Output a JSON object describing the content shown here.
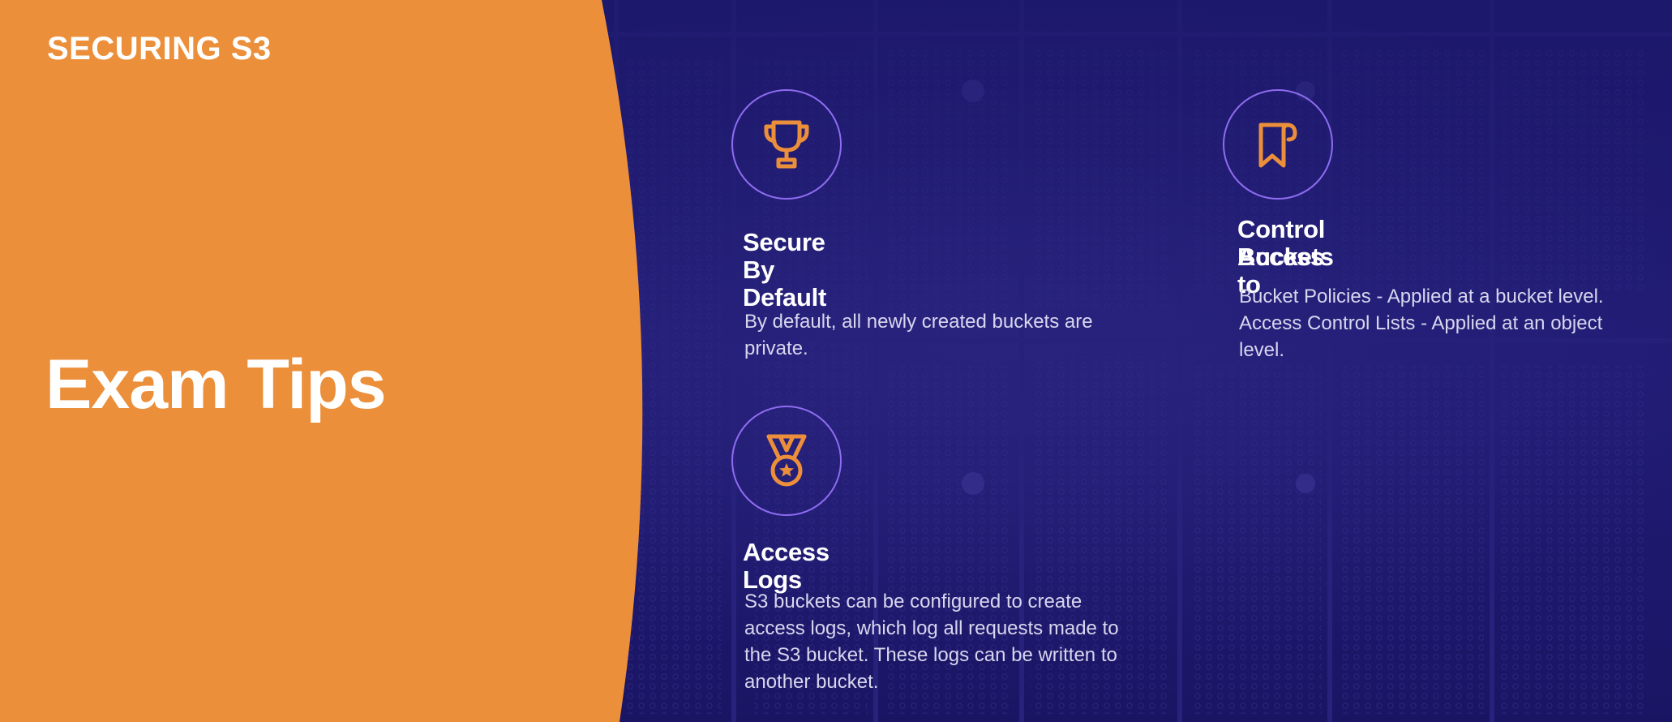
{
  "header": {
    "course_label": "SECURING S3"
  },
  "title": "Exam Tips",
  "colors": {
    "accent_orange": "#ec8f3a",
    "background_navy": "#1e1a70",
    "icon_ring_purple": "#8f6cf0"
  },
  "tips": [
    {
      "icon": "trophy-icon",
      "heading": "Secure By Default",
      "body": "By default, all newly created buckets are private."
    },
    {
      "icon": "bookmark-scroll-icon",
      "heading_line1": "Control Access to",
      "heading_line2": "Buckets",
      "body_line1": "Bucket Policies - Applied at a bucket level.",
      "body_line2": "Access Control Lists - Applied at an object level."
    },
    {
      "icon": "medal-icon",
      "heading": "Access Logs",
      "body": "S3 buckets can be configured to create access logs, which log all requests made to the S3 bucket. These logs can be written to another bucket."
    }
  ]
}
